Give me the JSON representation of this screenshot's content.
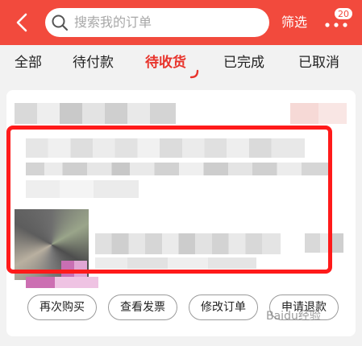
{
  "header": {
    "search_placeholder": "搜索我的订单",
    "filter_label": "筛选",
    "more_badge_count": "20",
    "bg_color": "#f24a3d"
  },
  "tabs": [
    {
      "label": "全部",
      "active": false
    },
    {
      "label": "待付款",
      "active": false
    },
    {
      "label": "待收货",
      "active": true
    },
    {
      "label": "已完成",
      "active": false
    },
    {
      "label": "已取消",
      "active": false
    }
  ],
  "order": {
    "content_blurred": true,
    "actions": [
      {
        "label": "再次购买"
      },
      {
        "label": "查看发票"
      },
      {
        "label": "修改订单"
      },
      {
        "label": "申请退款"
      }
    ]
  },
  "watermark": "Baidu经验",
  "colors": {
    "accent": "#e8332b",
    "highlight_box": "#ff1a1a"
  }
}
